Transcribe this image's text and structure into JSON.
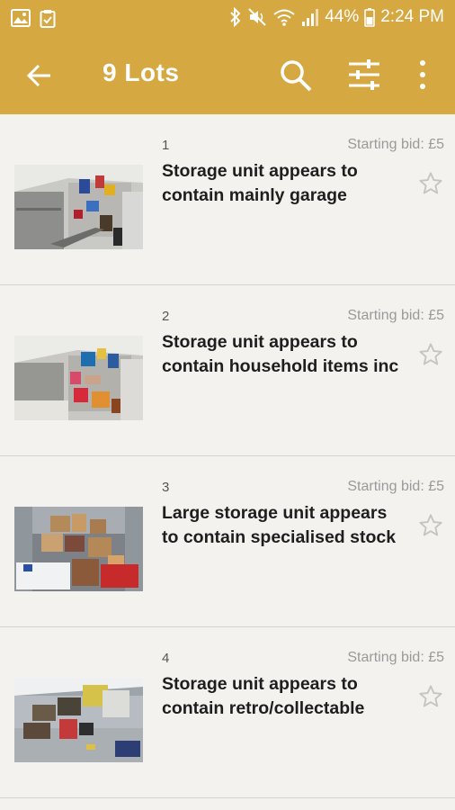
{
  "status_bar": {
    "battery": "44%",
    "time": "2:24 PM"
  },
  "app_bar": {
    "title": "9 Lots"
  },
  "lots": [
    {
      "number": "1",
      "bid": "Starting bid: £5",
      "title": "Storage unit appears to contain mainly garage"
    },
    {
      "number": "2",
      "bid": "Starting bid: £5",
      "title": "Storage unit appears to contain household items inc"
    },
    {
      "number": "3",
      "bid": "Starting bid: £5",
      "title": "Large storage unit appears to contain specialised stock"
    },
    {
      "number": "4",
      "bid": "Starting bid: £5",
      "title": "Storage unit appears to contain retro/collectable"
    }
  ],
  "colors": {
    "accent": "#d6a842",
    "background": "#f3f2ef"
  }
}
